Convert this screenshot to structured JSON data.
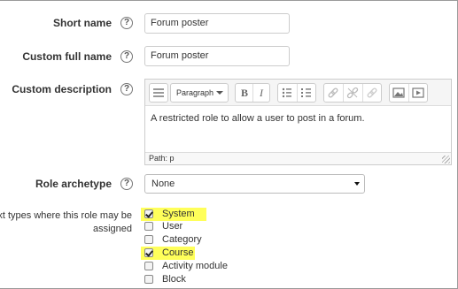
{
  "form": {
    "short_name": {
      "label": "Short name",
      "value": "Forum poster"
    },
    "custom_full_name": {
      "label": "Custom full name",
      "value": "Forum poster"
    },
    "custom_description": {
      "label": "Custom description",
      "toolbar": {
        "paragraph_label": "Paragraph",
        "bold": "B",
        "italic": "I",
        "icons": [
          "collapse-icon",
          "bold-icon",
          "italic-icon",
          "unordered-list-icon",
          "ordered-list-icon",
          "link-icon",
          "unlink-icon",
          "link-disabled-icon",
          "image-icon",
          "media-icon"
        ]
      },
      "content": "A restricted role to allow a user to post in a forum.",
      "path": "Path: p"
    },
    "role_archetype": {
      "label": "Role archetype",
      "value": "None"
    },
    "context_types": {
      "label_line1": "xt types where this role may be",
      "label_line2": "assigned",
      "options": [
        {
          "label": "System",
          "checked": true,
          "highlighted": true
        },
        {
          "label": "User",
          "checked": false,
          "highlighted": false
        },
        {
          "label": "Category",
          "checked": false,
          "highlighted": false
        },
        {
          "label": "Course",
          "checked": true,
          "highlighted": true
        },
        {
          "label": "Activity module",
          "checked": false,
          "highlighted": false
        },
        {
          "label": "Block",
          "checked": false,
          "highlighted": false
        }
      ]
    },
    "help_glyph": "?"
  },
  "colors": {
    "highlight": "#ffff5a",
    "border": "#cccccc",
    "toolbar_bg": "#f5f5f5"
  }
}
